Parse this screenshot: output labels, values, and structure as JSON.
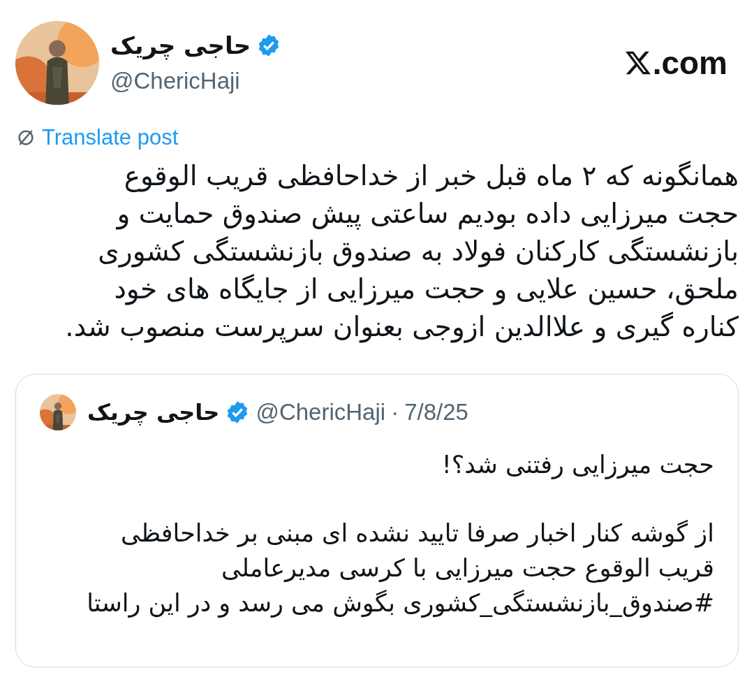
{
  "author": {
    "name": "حاجی چریک",
    "verified": true,
    "handle": "@ChericHaji"
  },
  "site": {
    "suffix": ".com"
  },
  "translate": {
    "label": "Translate post"
  },
  "post": {
    "text": "همانگونه که ۲ ماه قبل خبر از خداحافظی قریب الوقوع\nحجت میرزایی داده بودیم ساعتی پیش صندوق حمایت و\nبازنشستگی کارکنان فولاد به صندوق بازنشستگی کشوری\nملحق، حسین علایی و حجت میرزایی از جایگاه های خود\nکناره گیری و علاالدین ازوجی بعنوان سرپرست منصوب شد."
  },
  "quote": {
    "name": "حاجی چریک",
    "verified": true,
    "handle": "@ChericHaji",
    "separator": "·",
    "date": "7/8/25",
    "paragraphs": [
      "حجت میرزایی رفتنی شد؟!",
      "از گوشه کنار اخبار صرفا تایید نشده ای مبنی بر خداحافظی\nقریب الوقوع حجت میرزایی با کرسی مدیرعاملی\n#صندوق_بازنشستگی_کشوری بگوش می رسد و در این راستا"
    ]
  }
}
